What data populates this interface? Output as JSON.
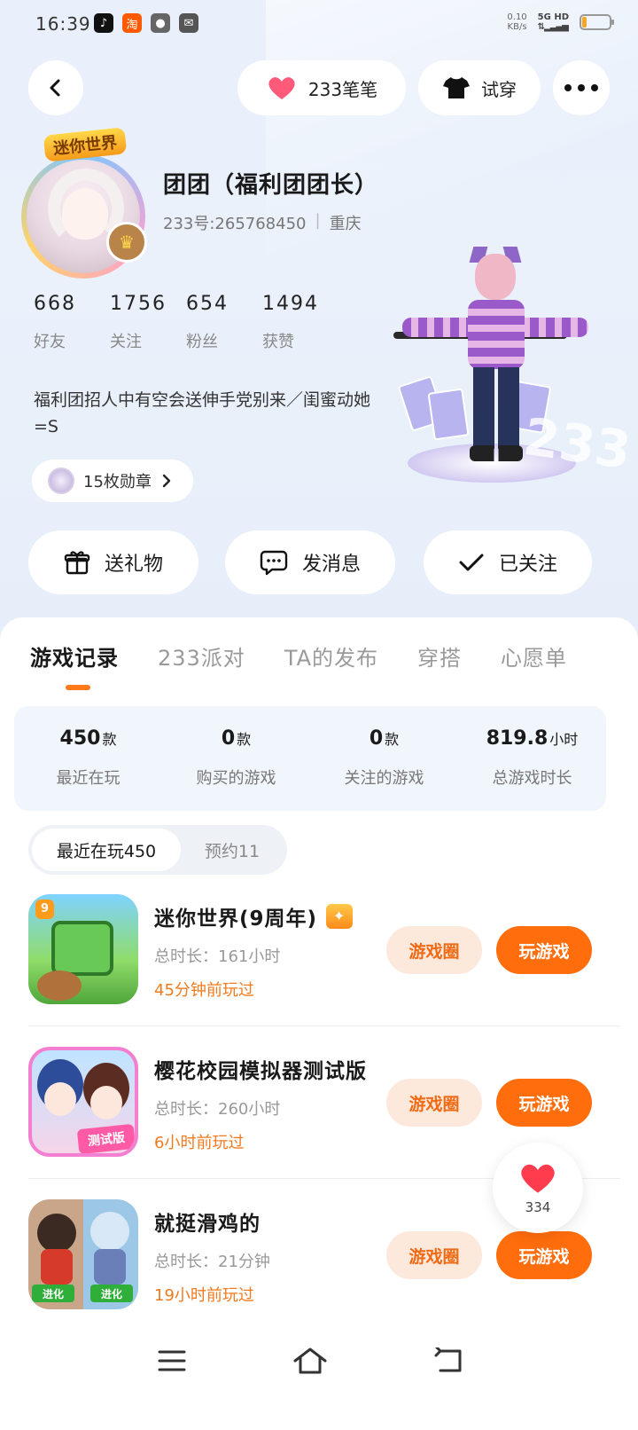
{
  "status_bar": {
    "time": "16:39",
    "apps": [
      {
        "icon": "tiktok-icon",
        "color": "#111111",
        "glyph": "♪"
      },
      {
        "icon": "taobao-icon",
        "color": "#ff5a00",
        "glyph": "淘"
      },
      {
        "icon": "wechat-icon",
        "color": "#555555",
        "glyph": "●"
      },
      {
        "icon": "message-app-icon",
        "color": "#555555",
        "glyph": "✉"
      }
    ],
    "net_speed_value": "0.10",
    "net_speed_unit": "KB/s",
    "network_label": "5G HD",
    "battery_level": 0.15
  },
  "top_bar": {
    "friends_label": "233笔笔",
    "tryon_label": "试穿"
  },
  "profile": {
    "avatar_logo_text": "迷你世界",
    "nickname": "团团（福利团团长）",
    "uid": "233号:265768450",
    "location": "重庆",
    "stats": [
      {
        "value": "668",
        "label": "好友"
      },
      {
        "value": "1756",
        "label": "关注"
      },
      {
        "value": "654",
        "label": "粉丝"
      },
      {
        "value": "1494",
        "label": "获赞"
      }
    ],
    "bio": "福利团招人中有空会送伸手党别来／闺蜜动她=S",
    "badges_label": "15枚勋章"
  },
  "actions": {
    "gift": "送礼物",
    "message": "发消息",
    "follow": "已关注"
  },
  "tabs": [
    "游戏记录",
    "233派对",
    "TA的发布",
    "穿搭",
    "心愿单"
  ],
  "summary": [
    {
      "value": "450",
      "unit": "款",
      "label": "最近在玩"
    },
    {
      "value": "0",
      "unit": "款",
      "label": "购买的游戏"
    },
    {
      "value": "0",
      "unit": "款",
      "label": "关注的游戏"
    },
    {
      "value": "819.8",
      "unit": "小时",
      "label": "总游戏时长"
    }
  ],
  "segments": {
    "recent": "最近在玩450",
    "reserved": "预约11"
  },
  "games": [
    {
      "title": "迷你世界(9周年)",
      "duration": "总时长：161小时",
      "played": "45分钟前玩过",
      "circle": "游戏圈",
      "play": "玩游戏"
    },
    {
      "title": "樱花校园模拟器测试版",
      "duration": "总时长：260小时",
      "played": "6小时前玩过",
      "circle": "游戏圈",
      "play": "玩游戏",
      "icon_tag": "测试版"
    },
    {
      "title": "就挺滑鸡的",
      "duration": "总时长：21分钟",
      "played": "19小时前玩过",
      "circle": "游戏圈",
      "play": "玩游戏",
      "icon_tag_left": "进化",
      "icon_tag_right": "进化"
    }
  ],
  "like_float": {
    "count": "334"
  },
  "hero_decor_text": "233"
}
